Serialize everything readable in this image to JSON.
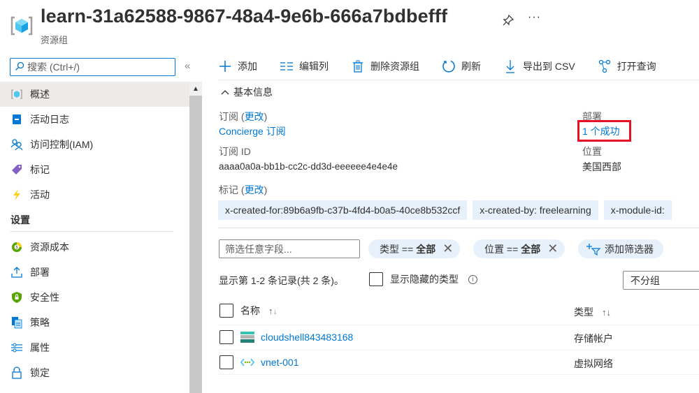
{
  "header": {
    "title": "learn-31a62588-9867-48a4-9e6b-666a7bdbefff",
    "subtitle": "资源组",
    "more_label": "···"
  },
  "sidebar": {
    "search_placeholder": "搜索 (Ctrl+/)",
    "collapse_label": "«",
    "items": [
      {
        "label": "概述",
        "icon": "resource-group-icon",
        "active": true
      },
      {
        "label": "活动日志",
        "icon": "activity-log-icon"
      },
      {
        "label": "访问控制(IAM)",
        "icon": "iam-icon"
      },
      {
        "label": "标记",
        "icon": "tag-icon"
      },
      {
        "label": "活动",
        "icon": "lightning-icon"
      }
    ],
    "section_settings": "设置",
    "settings_items": [
      {
        "label": "资源成本",
        "icon": "cost-icon"
      },
      {
        "label": "部署",
        "icon": "deploy-icon"
      },
      {
        "label": "安全性",
        "icon": "security-shield-icon"
      },
      {
        "label": "策略",
        "icon": "policy-icon"
      },
      {
        "label": "属性",
        "icon": "properties-icon"
      },
      {
        "label": "锁定",
        "icon": "lock-icon"
      }
    ]
  },
  "toolbar": {
    "add": "添加",
    "edit_columns": "编辑列",
    "delete_group": "删除资源组",
    "refresh": "刷新",
    "export_csv": "导出到 CSV",
    "open_query": "打开查询"
  },
  "essentials": {
    "toggle_label": "基本信息",
    "subscription_label": "订阅",
    "change_label": "更改",
    "subscription_value": "Concierge 订阅",
    "subscription_id_label": "订阅 ID",
    "subscription_id_value": "aaaa0a0a-bb1b-cc2c-dd3d-eeeeee4e4e4e",
    "tags_label": "标记",
    "deployments_label": "部署",
    "deployments_value": "1 个成功",
    "location_label": "位置",
    "location_value": "美国西部",
    "tags": [
      "x-created-for:89b6a9fb-c37b-4fd4-b0a5-40ce8b532ccf",
      "x-created-by: freelearning",
      "x-module-id:"
    ]
  },
  "filters": {
    "input_placeholder": "筛选任意字段...",
    "type_filter_key": "类型 ==",
    "type_filter_value": "全部",
    "location_filter_key": "位置 ==",
    "location_filter_value": "全部",
    "add_filter": "添加筛选器"
  },
  "list": {
    "records_text": "显示第 1-2 条记录(共 2 条)。",
    "show_hidden_types": "显示隐藏的类型",
    "grouping": "不分组",
    "columns": {
      "name": "名称",
      "type": "类型"
    },
    "rows": [
      {
        "name": "cloudshell843483168",
        "type": "存储帐户",
        "icon": "storage-account-icon"
      },
      {
        "name": "vnet-001",
        "type": "虚拟网络",
        "icon": "virtual-network-icon"
      }
    ]
  },
  "colors": {
    "accent": "#0078d4",
    "highlight_box": "#e81123",
    "chip_bg": "#e7f1fb"
  }
}
